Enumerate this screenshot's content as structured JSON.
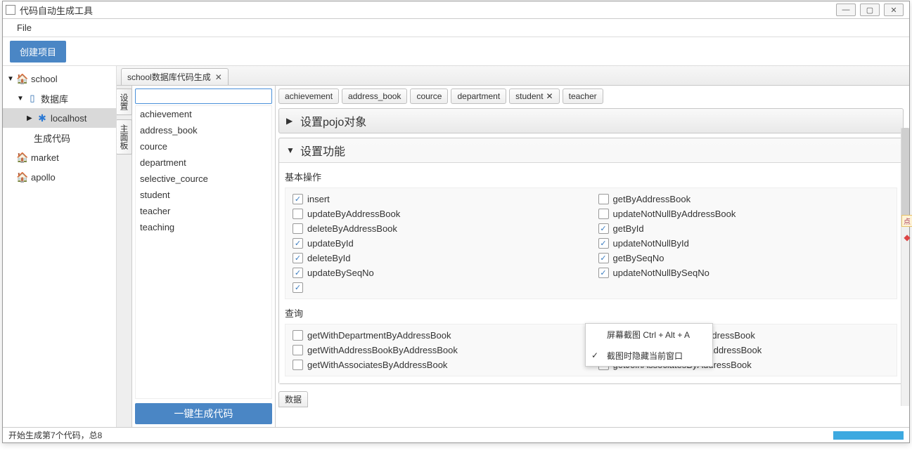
{
  "window": {
    "title": "代码自动生成工具"
  },
  "menubar": {
    "file": "File"
  },
  "toolbar": {
    "create_project": "创建项目"
  },
  "sidebar": {
    "items": [
      {
        "label": "school",
        "icon": "home",
        "depth": 0,
        "expanded": true
      },
      {
        "label": "数据库",
        "icon": "device",
        "depth": 1,
        "expanded": true
      },
      {
        "label": "localhost",
        "icon": "bluetooth",
        "depth": 2,
        "expanded": false,
        "selected": true
      },
      {
        "label": "生成代码",
        "icon": "",
        "depth": 2
      },
      {
        "label": "market",
        "icon": "home",
        "depth": 0
      },
      {
        "label": "apollo",
        "icon": "home",
        "depth": 0
      }
    ]
  },
  "content_tab": {
    "label": "school数据库代码生成"
  },
  "vtabs": {
    "settings": "设置",
    "main_panel": "主面板"
  },
  "leftpanel": {
    "search_placeholder": "",
    "items": [
      "achievement",
      "address_book",
      "cource",
      "department",
      "selective_cource",
      "student",
      "teacher",
      "teaching"
    ],
    "generate_btn": "一键生成代码"
  },
  "pilltabs": [
    "achievement",
    "address_book",
    "cource",
    "department",
    "student",
    "teacher"
  ],
  "active_pill": "student",
  "accordion": {
    "pojo": "设置pojo对象",
    "func": "设置功能"
  },
  "basic_ops_label": "基本操作",
  "basic_ops": [
    {
      "label": "insert",
      "checked": true
    },
    {
      "label": "getByAddressBook",
      "checked": false
    },
    {
      "label": "updateByAddressBook",
      "checked": false
    },
    {
      "label": "updateNotNullByAddressBook",
      "checked": false
    },
    {
      "label": "deleteByAddressBook",
      "checked": false
    },
    {
      "label": "getById",
      "checked": true
    },
    {
      "label": "updateById",
      "checked": true
    },
    {
      "label": "updateNotNullById",
      "checked": true
    },
    {
      "label": "deleteById",
      "checked": true
    },
    {
      "label": "getBySeqNo",
      "checked": true
    },
    {
      "label": "updateBySeqNo",
      "checked": true
    },
    {
      "label": "updateNotNullBySeqNo",
      "checked": true
    },
    {
      "label": "",
      "checked": true
    }
  ],
  "query_label": "查询",
  "query_ops": [
    {
      "label": "getWithDepartmentByAddressBook",
      "checked": false
    },
    {
      "label": "getJoinDepartmentByAddressBook",
      "checked": false
    },
    {
      "label": "getWithAddressBookByAddressBook",
      "checked": false
    },
    {
      "label": "getJoinAddressBookByAddressBook",
      "checked": false
    },
    {
      "label": "getWithAssociatesByAddressBook",
      "checked": false
    },
    {
      "label": "getJoinAssociatesByAddressBook",
      "checked": false
    }
  ],
  "bottom_tab": "数据",
  "statusbar": {
    "text": "开始生成第7个代码，总8"
  },
  "contextmenu": {
    "items": [
      {
        "label": "屏幕截图 Ctrl + Alt + A",
        "checked": false
      },
      {
        "label": "截图时隐藏当前窗口",
        "checked": true
      }
    ]
  },
  "sidemarker": "点"
}
